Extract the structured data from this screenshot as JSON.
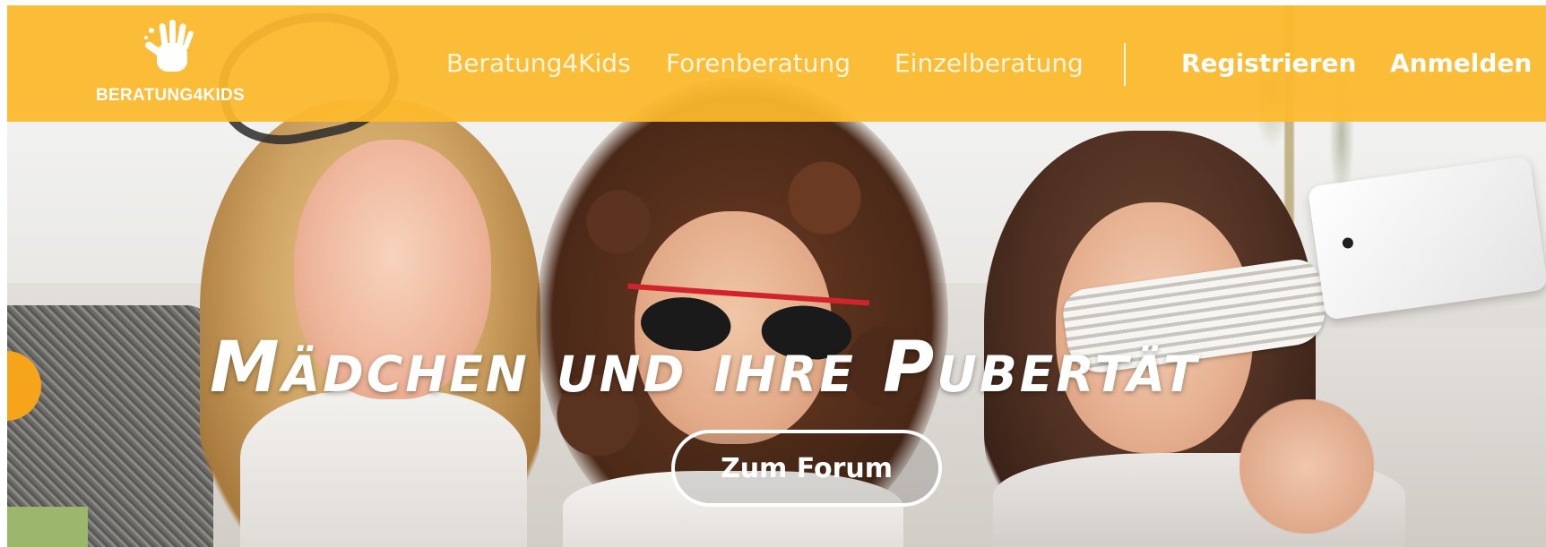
{
  "brand": {
    "logo_text": "BERATUNG4KIDS",
    "logo_icon": "hand-icon",
    "header_color": "#fdba2c",
    "accent_color": "#f6a51a"
  },
  "nav": {
    "items": [
      {
        "label": "Beratung4Kids"
      },
      {
        "label": "Forenberatung"
      },
      {
        "label": "Einzelberatung"
      }
    ],
    "register_label": "Registrieren",
    "login_label": "Anmelden"
  },
  "hero": {
    "title": "Mädchen und ihre Pubertät",
    "cta_label": "Zum Forum"
  }
}
